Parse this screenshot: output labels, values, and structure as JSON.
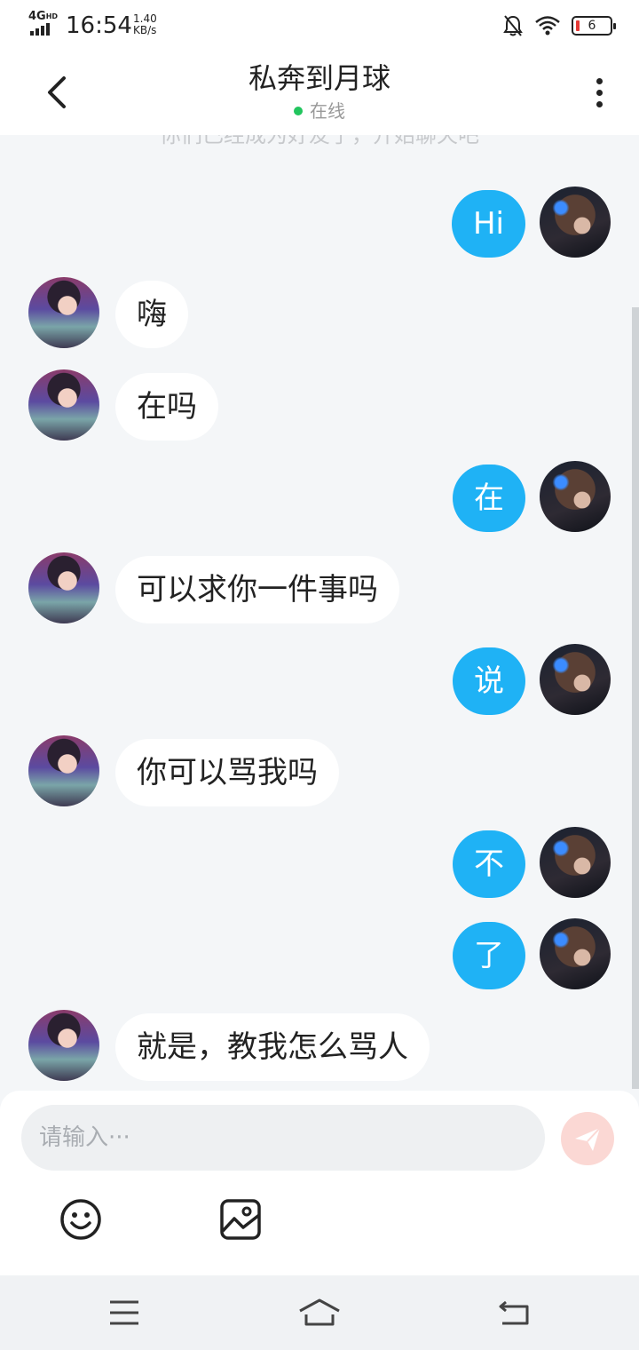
{
  "status_bar": {
    "network": "4G",
    "network_sup": "HD",
    "time": "16:54",
    "speed_value": "1.40",
    "speed_unit": "KB/s",
    "battery": "6",
    "icons": [
      "mute-bell-icon",
      "wifi-icon",
      "battery-icon"
    ]
  },
  "header": {
    "title": "私奔到月球",
    "status": "在线",
    "status_color": "#22c55e",
    "back_icon": "back-chevron-icon",
    "more_icon": "more-vertical-icon"
  },
  "chat": {
    "notice": "你们已经成为好友了，开始聊天吧",
    "messages": [
      {
        "side": "right",
        "text": "Hi"
      },
      {
        "side": "left",
        "text": "嗨"
      },
      {
        "side": "left",
        "text": "在吗"
      },
      {
        "side": "right",
        "text": "在"
      },
      {
        "side": "left",
        "text": "可以求你一件事吗"
      },
      {
        "side": "right",
        "text": "说"
      },
      {
        "side": "left",
        "text": "你可以骂我吗"
      },
      {
        "side": "right",
        "text": "不"
      },
      {
        "side": "right",
        "text": "了"
      },
      {
        "side": "left",
        "text": "就是，教我怎么骂人"
      }
    ],
    "outgoing_color": "#1fb2f5",
    "incoming_color": "#ffffff"
  },
  "composer": {
    "placeholder": "请输入···",
    "value": "",
    "send_icon": "send-plane-icon",
    "tools": [
      "emoji-icon",
      "image-icon"
    ]
  },
  "nav_bar": {
    "buttons": [
      "menu-icon",
      "home-icon",
      "back-icon"
    ]
  }
}
